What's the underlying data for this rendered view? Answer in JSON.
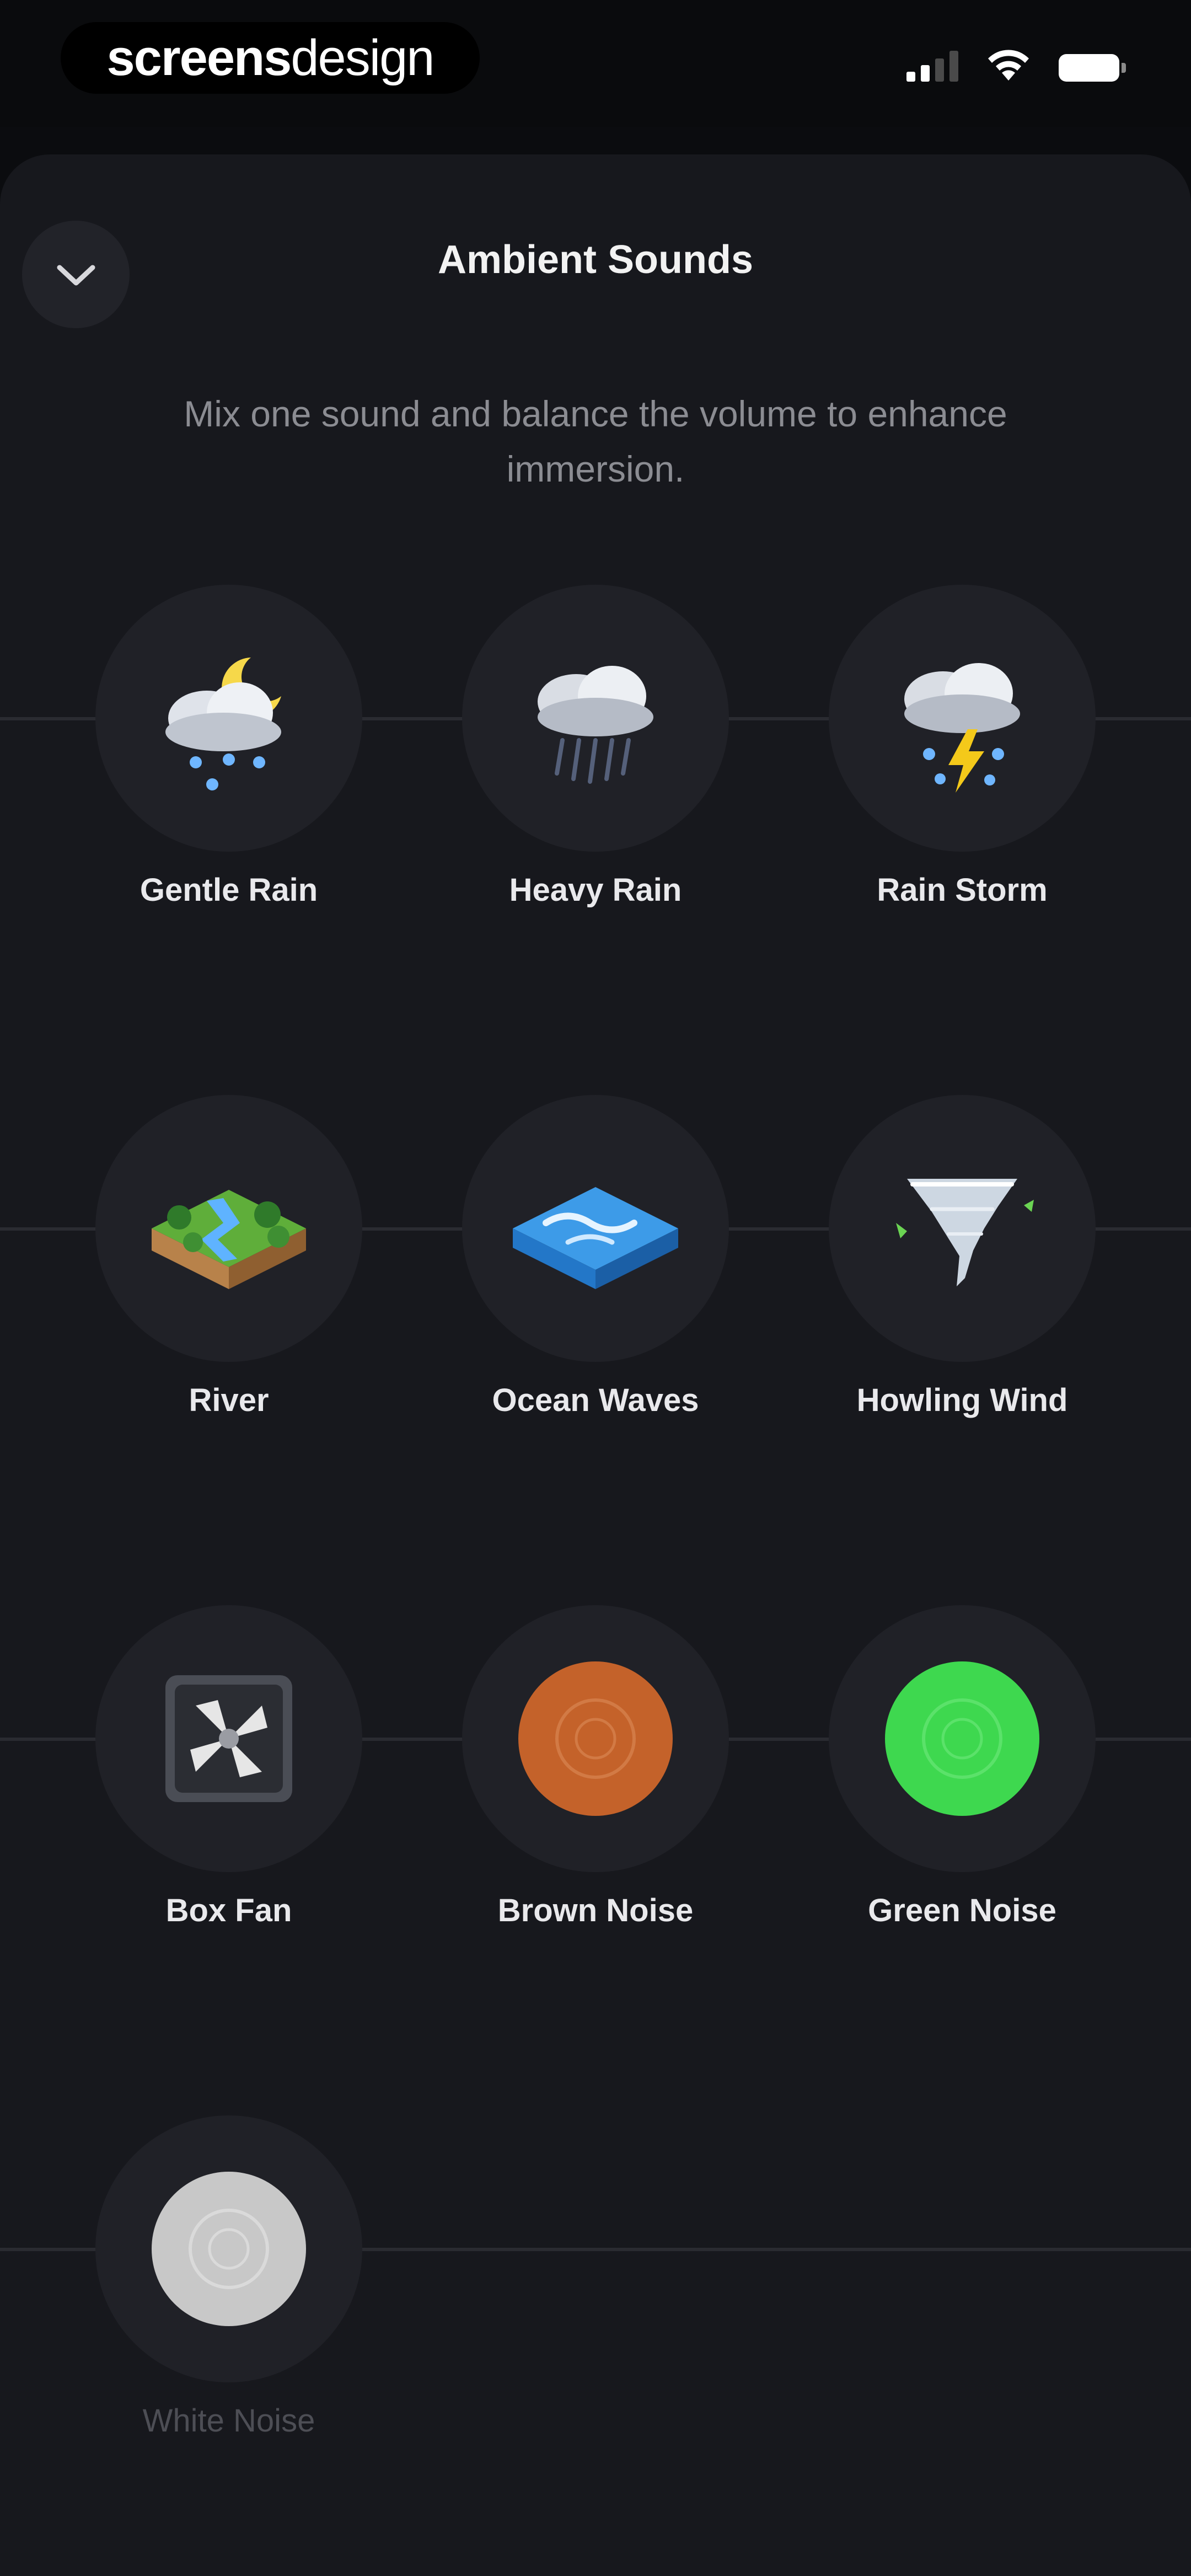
{
  "status_bar": {
    "brand_bold": "screens",
    "brand_light": "design"
  },
  "header": {
    "title": "Ambient Sounds",
    "collapse_icon": "chevron-down-icon"
  },
  "subtitle": "Mix one sound and balance the volume to enhance immersion.",
  "sounds": [
    {
      "label": "Gentle Rain",
      "icon": "cloud-moon-rain-icon"
    },
    {
      "label": "Heavy Rain",
      "icon": "cloud-heavy-rain-icon"
    },
    {
      "label": "Rain Storm",
      "icon": "cloud-lightning-icon"
    },
    {
      "label": "River",
      "icon": "river-island-icon"
    },
    {
      "label": "Ocean Waves",
      "icon": "ocean-tile-icon"
    },
    {
      "label": "Howling Wind",
      "icon": "tornado-icon"
    },
    {
      "label": "Box Fan",
      "icon": "box-fan-icon"
    },
    {
      "label": "Brown Noise",
      "icon": "brown-disc-icon"
    },
    {
      "label": "Green Noise",
      "icon": "green-disc-icon"
    },
    {
      "label": "White Noise",
      "icon": "white-disc-icon"
    }
  ],
  "colors": {
    "background": "#0b0c0f",
    "sheet": "#17181d",
    "circle": "#202127",
    "brown_noise": "#c4622a",
    "green_noise": "#3ed84f",
    "white_noise": "#c8c8c8",
    "lightning": "#f4c91a",
    "moon": "#f6d84a"
  }
}
